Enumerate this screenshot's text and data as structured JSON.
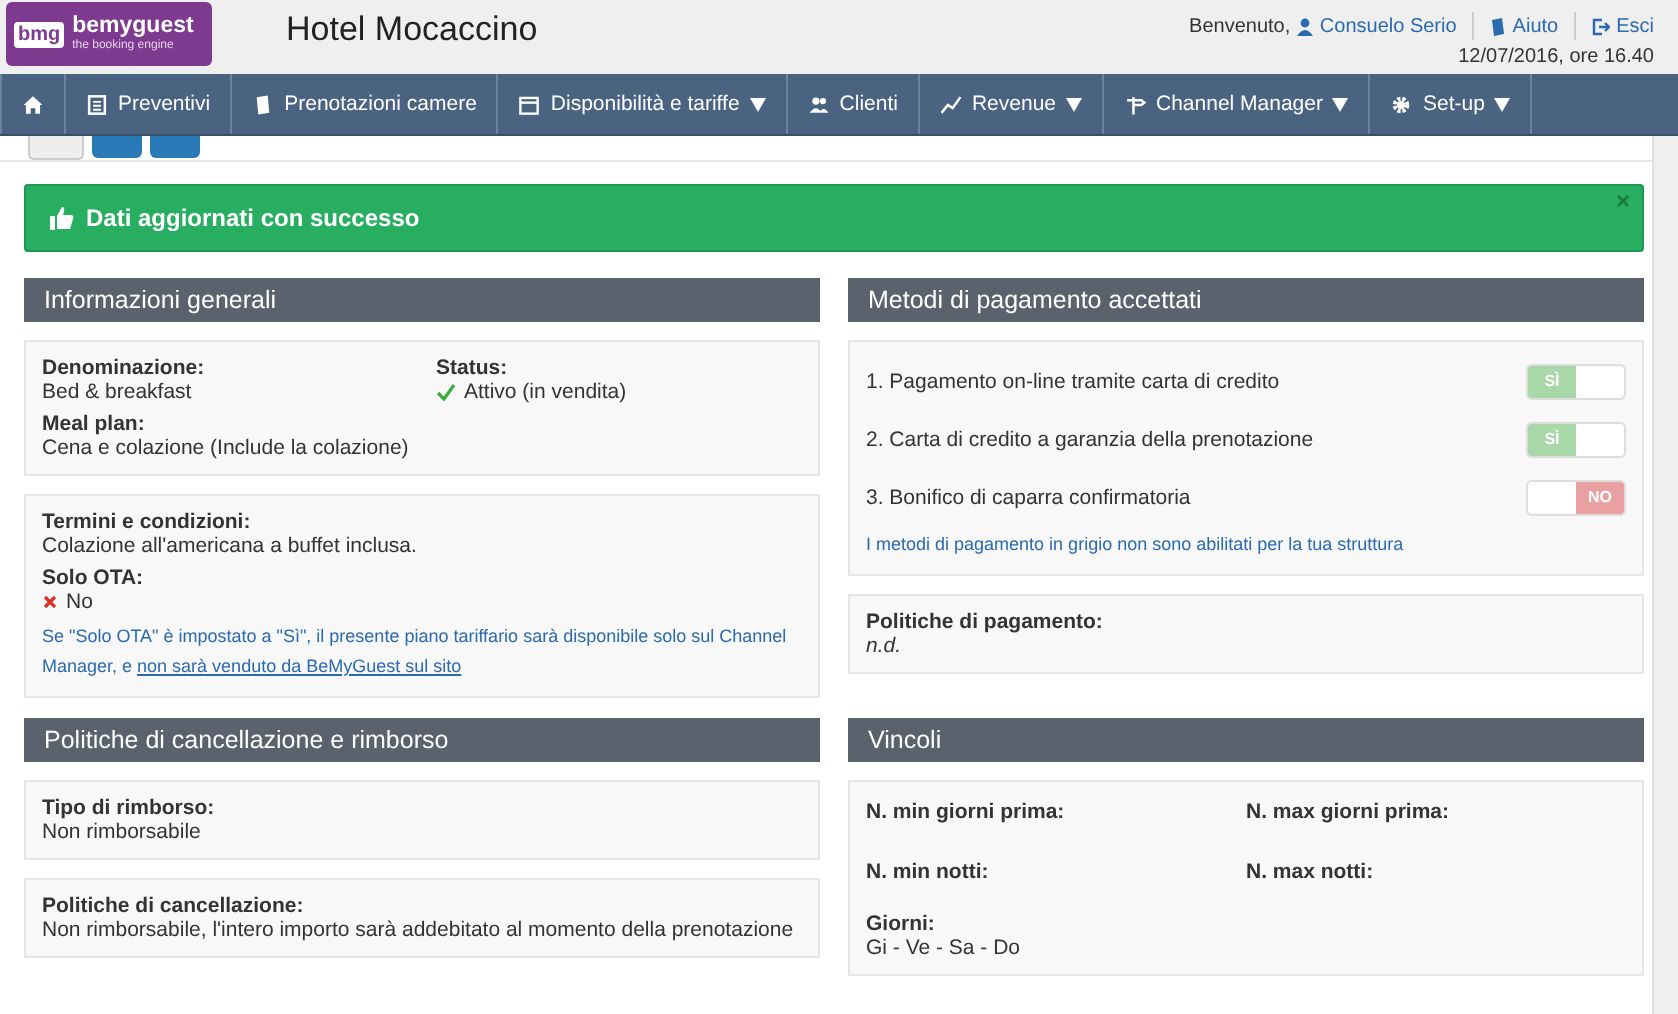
{
  "header": {
    "logo": {
      "mark": "bmg",
      "brand": "bemyguest",
      "tagline": "the booking engine"
    },
    "hotel_name": "Hotel Mocaccino",
    "welcome": "Benvenuto,",
    "user": "Consuelo Serio",
    "links": [
      {
        "label": "Aiuto"
      },
      {
        "label": "Esci"
      }
    ],
    "datetime": "12/07/2016, ore 16.40"
  },
  "nav": [
    {
      "dropdown": false
    },
    {
      "label": "Preventivi",
      "dropdown": false
    },
    {
      "label": "Prenotazioni camere",
      "dropdown": false
    },
    {
      "label": "Disponibilità e tariffe",
      "dropdown": true
    },
    {
      "label": "Clienti",
      "dropdown": false
    },
    {
      "label": "Revenue",
      "dropdown": true
    },
    {
      "label": "Channel Manager",
      "dropdown": true
    },
    {
      "label": "Set-up",
      "dropdown": true
    }
  ],
  "alert": {
    "message": "Dati aggiornati con successo",
    "dismissible": true
  },
  "general": {
    "title": "Informazioni generali",
    "card_1": [
      {
        "label": "Denominazione:",
        "value": "Bed & breakfast"
      },
      {
        "label": "Status:",
        "value": "Attivo (in vendita)",
        "ok": true
      },
      {
        "label": "Meal plan:",
        "value": "Cena e colazione (Include la colazione)"
      }
    ],
    "card_2": [
      {
        "label": "Termini e condizioni:",
        "value": "Colazione all'americana a buffet inclusa."
      },
      {
        "label": "Solo OTA:",
        "value": "No",
        "ok": false
      }
    ],
    "note": "Se \"Solo OTA\" è impostato a \"Sì\", il presente piano tariffario sarà disponibile solo sul Channel Manager, e ",
    "note_link": "non sarà venduto da BeMyGuest sul sito"
  },
  "payments": {
    "title": "Metodi di pagamento accettati",
    "methods": [
      {
        "label": "1. Pagamento on-line tramite carta di credito",
        "on": true,
        "toggle_label": "SÌ"
      },
      {
        "label": "2. Carta di credito a garanzia della prenotazione",
        "on": true,
        "toggle_label": "SÌ"
      },
      {
        "label": "3. Bonifico di caparra confirmatoria",
        "on": false,
        "toggle_label": "NO"
      }
    ],
    "note": "I metodi di pagamento in grigio non sono abilitati per la tua struttura",
    "policy": {
      "label": "Politiche di pagamento:",
      "value": "n.d.",
      "kind": "missing"
    }
  },
  "cancellation": {
    "title": "Politiche di cancellazione e rimborso",
    "cards": [
      {
        "label": "Tipo di rimborso:",
        "value": "Non rimborsabile"
      },
      {
        "label": "Politiche di cancellazione:",
        "value": "Non rimborsabile, l'intero importo sarà addebitato al momento della prenotazione"
      }
    ]
  },
  "constraints": {
    "title": "Vincoli",
    "fields": [
      {
        "label": "N. min giorni prima:"
      },
      {
        "label": "N. max giorni prima:"
      },
      {
        "label": "N. min notti:"
      },
      {
        "label": "N. max notti:"
      }
    ],
    "days": {
      "label": "Giorni:",
      "value": "Gi - Ve - Sa - Do"
    }
  }
}
